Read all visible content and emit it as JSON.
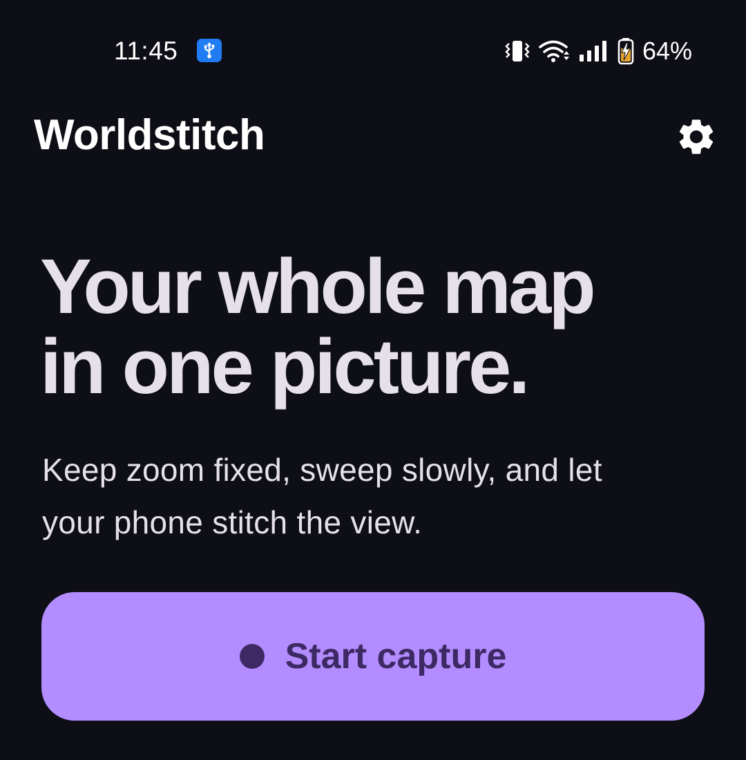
{
  "status_bar": {
    "time": "11:45",
    "battery_percent": "64%",
    "icons": [
      "usb-icon",
      "vibrate-icon",
      "wifi-icon",
      "signal-icon",
      "battery-charging-icon"
    ]
  },
  "app_bar": {
    "title": "Worldstitch",
    "settings_icon": "gear-icon"
  },
  "hero": {
    "headline_lines": [
      "Your whole map",
      "in one picture."
    ],
    "subtitle_lines": [
      "Keep zoom fixed, sweep slowly, and let",
      "your phone stitch the view."
    ]
  },
  "cta": {
    "label": "Start capture",
    "icon": "record-dot-icon"
  },
  "colors": {
    "background": "#0e0e16",
    "text": "#e6e1e9",
    "accent": "#b38cff",
    "on_accent": "#3d2963",
    "usb_badge": "#1f7cf2"
  }
}
